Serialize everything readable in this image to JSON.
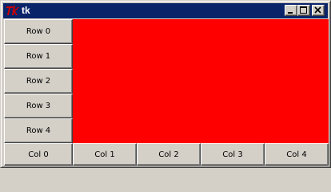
{
  "window": {
    "title": "tk",
    "logo_color": "#cc0000",
    "titlebar_color": "#0a246a"
  },
  "title_buttons": {
    "minimize_icon": "minimize-icon",
    "maximize_icon": "maximize-icon",
    "close_icon": "close-icon"
  },
  "row_buttons": [
    "Row 0",
    "Row 1",
    "Row 2",
    "Row 3",
    "Row 4"
  ],
  "col_buttons": [
    "Col 0",
    "Col 1",
    "Col 2",
    "Col 3",
    "Col 4"
  ],
  "canvas": {
    "fill_color": "#ff0000"
  }
}
